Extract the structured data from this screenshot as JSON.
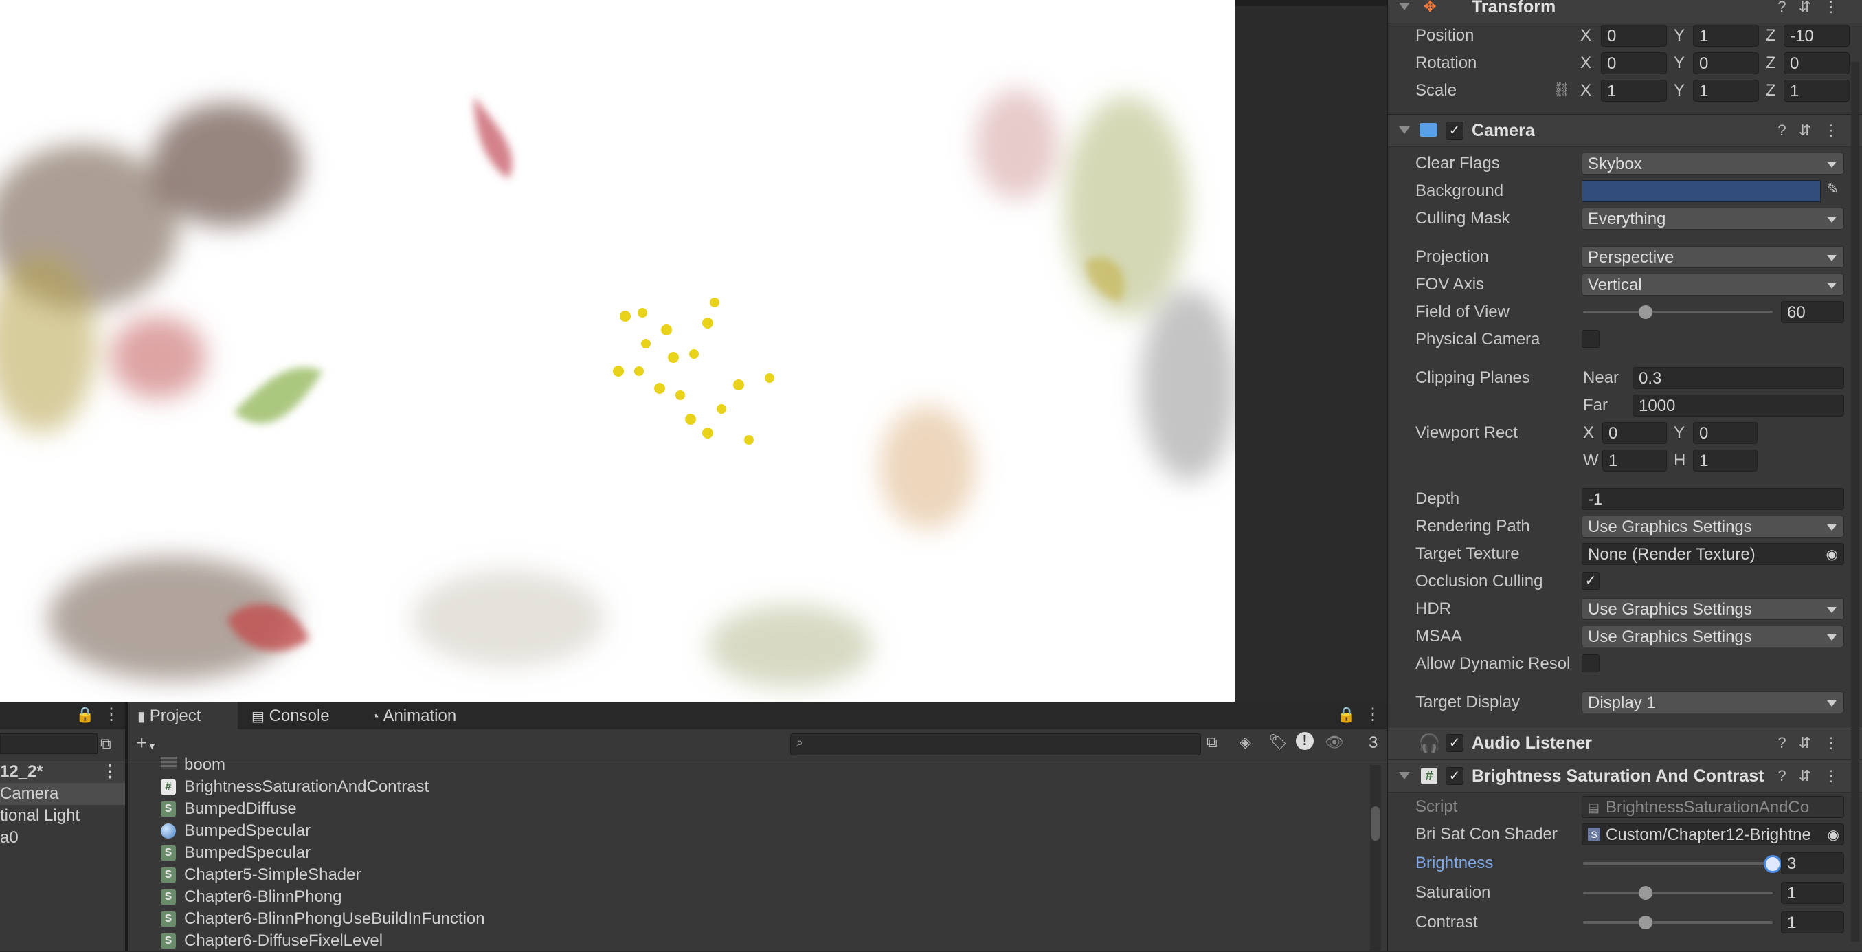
{
  "scene": {
    "background_color": "#ffffff"
  },
  "inspector": {
    "transform": {
      "title": "Transform",
      "position": {
        "label": "Position",
        "x": "0",
        "y": "1",
        "z": "-10"
      },
      "rotation": {
        "label": "Rotation",
        "x": "0",
        "y": "0",
        "z": "0"
      },
      "scale": {
        "label": "Scale",
        "x": "1",
        "y": "1",
        "z": "1"
      },
      "axis_x": "X",
      "axis_y": "Y",
      "axis_z": "Z"
    },
    "camera": {
      "title": "Camera",
      "clear_flags": {
        "label": "Clear Flags",
        "value": "Skybox"
      },
      "background": {
        "label": "Background",
        "color": "#314d79"
      },
      "culling_mask": {
        "label": "Culling Mask",
        "value": "Everything"
      },
      "projection": {
        "label": "Projection",
        "value": "Perspective"
      },
      "fov_axis": {
        "label": "FOV Axis",
        "value": "Vertical"
      },
      "field_of_view": {
        "label": "Field of View",
        "value": "60",
        "fraction": 0.33
      },
      "physical_camera": {
        "label": "Physical Camera"
      },
      "clipping_planes": {
        "label": "Clipping Planes",
        "near_label": "Near",
        "near": "0.3",
        "far_label": "Far",
        "far": "1000"
      },
      "viewport_rect": {
        "label": "Viewport Rect",
        "x": "0",
        "y": "0",
        "w": "1",
        "h": "1",
        "w_label": "W",
        "h_label": "H"
      },
      "depth": {
        "label": "Depth",
        "value": "-1"
      },
      "rendering_path": {
        "label": "Rendering Path",
        "value": "Use Graphics Settings"
      },
      "target_texture": {
        "label": "Target Texture",
        "value": "None (Render Texture)"
      },
      "occlusion_culling": {
        "label": "Occlusion Culling",
        "checked": true
      },
      "hdr": {
        "label": "HDR",
        "value": "Use Graphics Settings"
      },
      "msaa": {
        "label": "MSAA",
        "value": "Use Graphics Settings"
      },
      "allow_dynamic": {
        "label": "Allow Dynamic Resol"
      },
      "target_display": {
        "label": "Target Display",
        "value": "Display 1"
      }
    },
    "audio_listener": {
      "title": "Audio Listener"
    },
    "bsc": {
      "title": "Brightness Saturation And Contrast",
      "script": {
        "label": "Script",
        "value": "BrightnessSaturationAndCo"
      },
      "shader": {
        "label": "Bri Sat Con Shader",
        "value": "Custom/Chapter12-Brightne"
      },
      "brightness": {
        "label": "Brightness",
        "value": "3",
        "fraction": 1.0
      },
      "saturation": {
        "label": "Saturation",
        "value": "1",
        "fraction": 0.33
      },
      "contrast": {
        "label": "Contrast",
        "value": "1",
        "fraction": 0.33
      }
    }
  },
  "hierarchy": {
    "scene_name": "12_2*",
    "items": [
      "Camera",
      "tional Light",
      "a0"
    ]
  },
  "project": {
    "tabs": [
      "Project",
      "Console",
      "Animation"
    ],
    "badge_count": "3",
    "items": [
      {
        "name": "boom",
        "icon": "texture-icon"
      },
      {
        "name": "BrightnessSaturationAndContrast",
        "icon": "csharp-icon"
      },
      {
        "name": "BumpedDiffuse",
        "icon": "shader-icon"
      },
      {
        "name": "BumpedSpecular",
        "icon": "material-icon"
      },
      {
        "name": "BumpedSpecular",
        "icon": "shader-icon"
      },
      {
        "name": "Chapter5-SimpleShader",
        "icon": "shader-icon"
      },
      {
        "name": "Chapter6-BlinnPhong",
        "icon": "shader-icon"
      },
      {
        "name": "Chapter6-BlinnPhongUseBuildInFunction",
        "icon": "shader-icon"
      },
      {
        "name": "Chapter6-DiffuseFixelLevel",
        "icon": "shader-icon"
      }
    ]
  }
}
